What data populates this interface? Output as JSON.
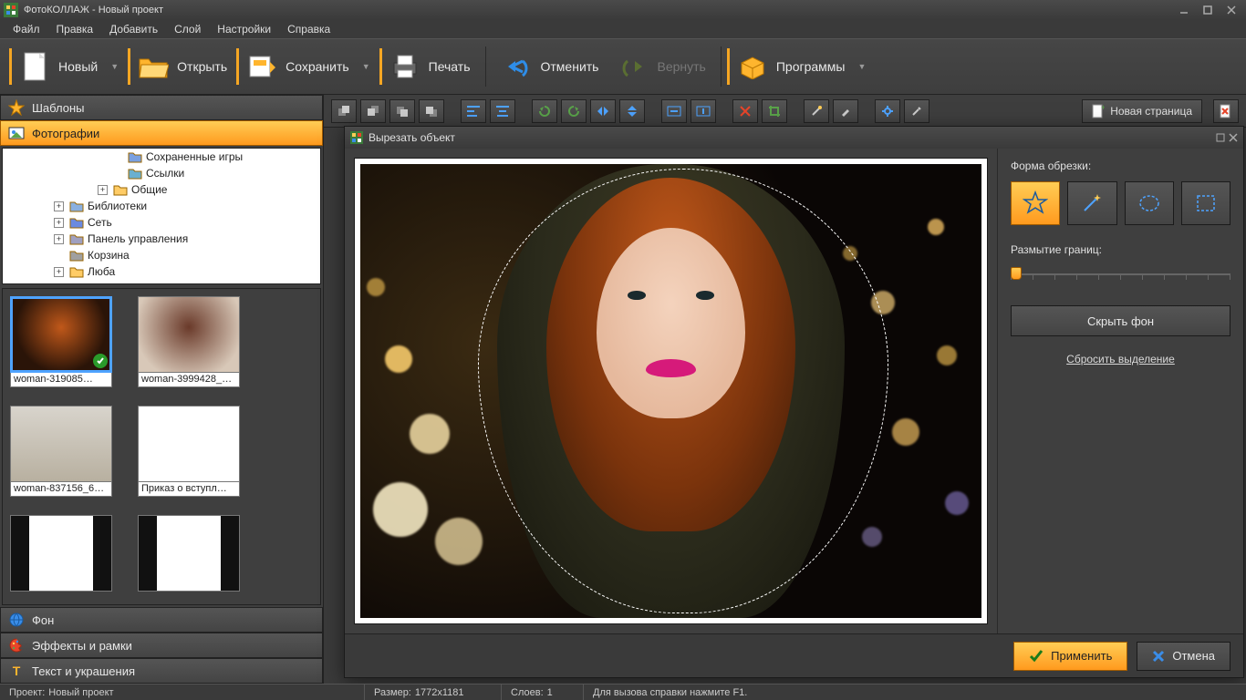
{
  "title": "ФотоКОЛЛАЖ - Новый проект",
  "menu": [
    "Файл",
    "Правка",
    "Добавить",
    "Слой",
    "Настройки",
    "Справка"
  ],
  "toolbar": {
    "new": "Новый",
    "open": "Открыть",
    "save": "Сохранить",
    "print": "Печать",
    "undo": "Отменить",
    "redo": "Вернуть",
    "programs": "Программы"
  },
  "left": {
    "templates": "Шаблоны",
    "photos": "Фотографии",
    "background": "Фон",
    "effects": "Эффекты и рамки",
    "text": "Текст и украшения",
    "tree": [
      {
        "label": "Сохраненные игры",
        "indent": 120,
        "exp": "",
        "icon": "game"
      },
      {
        "label": "Ссылки",
        "indent": 120,
        "exp": "",
        "icon": "link"
      },
      {
        "label": "Общие",
        "indent": 104,
        "exp": "+",
        "icon": "folder"
      },
      {
        "label": "Библиотеки",
        "indent": 56,
        "exp": "+",
        "icon": "library"
      },
      {
        "label": "Сеть",
        "indent": 56,
        "exp": "+",
        "icon": "network"
      },
      {
        "label": "Панель управления",
        "indent": 56,
        "exp": "+",
        "icon": "control"
      },
      {
        "label": "Корзина",
        "indent": 56,
        "exp": "",
        "icon": "trash"
      },
      {
        "label": "Люба",
        "indent": 56,
        "exp": "+",
        "icon": "folder"
      }
    ],
    "thumbs": [
      {
        "caption": "woman-319085…",
        "selected": true
      },
      {
        "caption": "woman-3999428_…"
      },
      {
        "caption": "woman-837156_6…"
      },
      {
        "caption": "Приказ о вступл…"
      },
      {
        "caption": ""
      },
      {
        "caption": ""
      }
    ]
  },
  "canvas_toolbar": {
    "new_page": "Новая страница"
  },
  "dialog": {
    "title": "Вырезать объект",
    "shape_label": "Форма обрезки:",
    "blur_label": "Размытие границ:",
    "hide_bg": "Скрыть фон",
    "reset": "Сбросить выделение",
    "apply": "Применить",
    "cancel": "Отмена"
  },
  "status": {
    "project_label": "Проект:",
    "project_value": "Новый проект",
    "size_label": "Размер:",
    "size_value": "1772x1181",
    "layers_label": "Слоев:",
    "layers_value": "1",
    "help": "Для вызова справки нажмите F1."
  }
}
